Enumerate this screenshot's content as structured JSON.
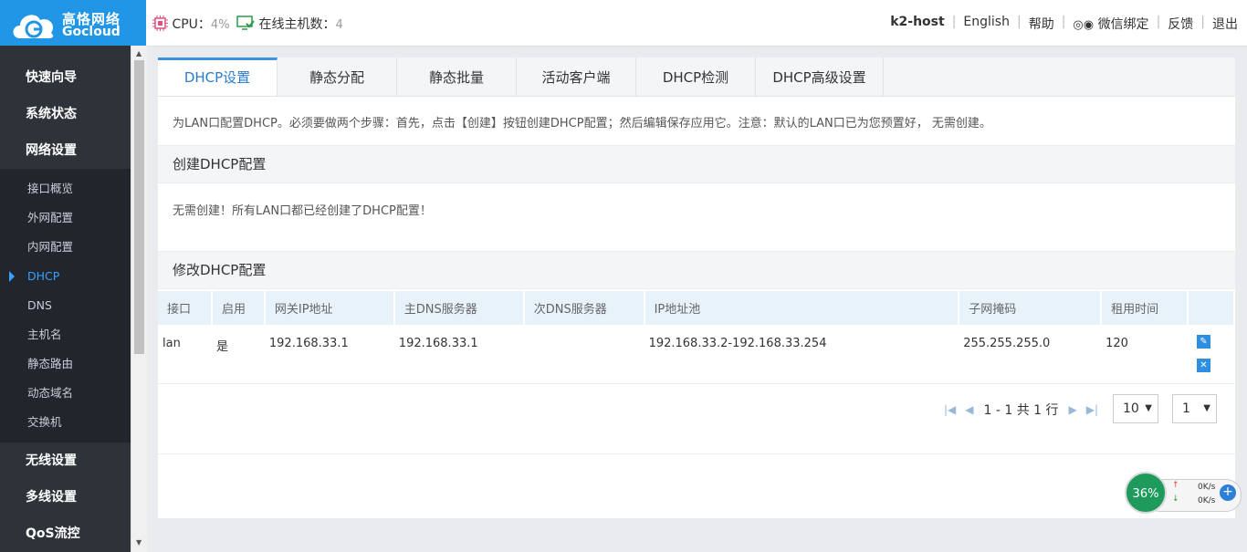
{
  "brand": {
    "cn": "高恪网络",
    "en": "Gocloud"
  },
  "header": {
    "cpu_label": "CPU：",
    "cpu_value": "4%",
    "hosts_label": "在线主机数：",
    "hosts_value": "4",
    "hostname": "k2-host",
    "links": [
      "English",
      "帮助",
      "微信绑定",
      "反馈",
      "退出"
    ]
  },
  "sidebar": {
    "top": [
      "快速向导",
      "系统状态",
      "网络设置"
    ],
    "sub": [
      "接口概览",
      "外网配置",
      "内网配置",
      "DHCP",
      "DNS",
      "主机名",
      "静态路由",
      "动态域名",
      "交换机"
    ],
    "bottom": [
      "无线设置",
      "多线设置",
      "QoS流控"
    ]
  },
  "tabs": [
    "DHCP设置",
    "静态分配",
    "静态批量",
    "活动客户端",
    "DHCP检测",
    "DHCP高级设置"
  ],
  "description": "为LAN口配置DHCP。必须要做两个步骤：首先，点击【创建】按钮创建DHCP配置；然后编辑保存应用它。注意：默认的LAN口已为您预置好， 无需创建。",
  "create_section": {
    "title": "创建DHCP配置",
    "message": "无需创建！所有LAN口都已经创建了DHCP配置！"
  },
  "edit_section": {
    "title": "修改DHCP配置"
  },
  "table": {
    "headers": [
      "接口",
      "启用",
      "网关IP地址",
      "主DNS服务器",
      "次DNS服务器",
      "IP地址池",
      "子网掩码",
      "租用时间",
      ""
    ],
    "rows": [
      [
        "lan",
        "是",
        "192.168.33.1",
        "192.168.33.1",
        "",
        "192.168.33.2-192.168.33.254",
        "255.255.255.0",
        "120"
      ]
    ]
  },
  "pagination": {
    "summary": "1 - 1 共 1 行",
    "page_size": "10",
    "page": "1"
  },
  "speed_widget": {
    "percent": "36%",
    "up": "0K/s",
    "down": "0K/s"
  },
  "colors": {
    "brand": "#2196e6",
    "sidebar": "#2d3339",
    "accent": "#3a94e0"
  }
}
